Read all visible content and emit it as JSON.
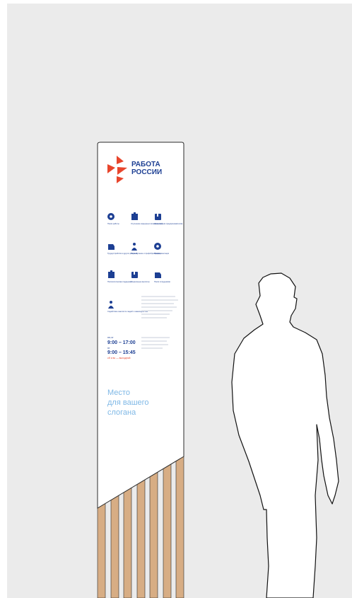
{
  "colors": {
    "background": "#ebebeb",
    "panel": "#ffffff",
    "brand_blue": "#1d3f93",
    "brand_red": "#e8452c",
    "slogan": "#7fb8e6",
    "wood": "#d7ad84",
    "figure_stroke": "#111111"
  },
  "brand": {
    "line1": "РАБОТА",
    "line2": "РОССИИ"
  },
  "services": [
    {
      "icon": "search-icon",
      "label": "Поиск работы"
    },
    {
      "icon": "puzzle-icon",
      "label": "Улучшение карьерных возможностей"
    },
    {
      "icon": "business-icon",
      "label": "Начинающим предпринимателям"
    },
    {
      "icon": "location-icon",
      "label": "Трудоустройство в других регионах"
    },
    {
      "icon": "refresh-icon",
      "label": "Переобучение и профобразование"
    },
    {
      "icon": "guidance-icon",
      "label": "Профориентация"
    },
    {
      "icon": "chart-icon",
      "label": "Психологическая поддержка"
    },
    {
      "icon": "document-icon",
      "label": "Социальные выплаты"
    },
    {
      "icon": "employer-icon",
      "label": "Поиск сотрудников"
    },
    {
      "icon": "accessibility-icon",
      "label": "Содействие занятости людей с инвалидностью"
    }
  ],
  "hours": {
    "weekdays_label": "пн-чт",
    "weekdays_time": "9:00 – 17:00",
    "friday_label": "пт",
    "friday_time": "9:00 – 15:45",
    "weekend_label": "сб и вс — выходной"
  },
  "slogan": {
    "line1": "Место",
    "line2": "для вашего",
    "line3": "слогана"
  }
}
